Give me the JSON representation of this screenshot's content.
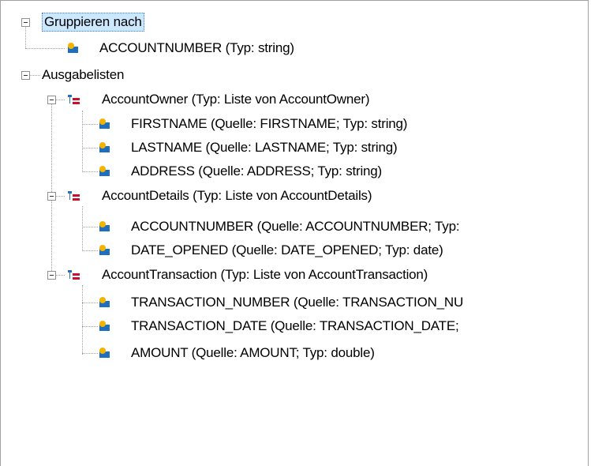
{
  "tree": {
    "group_by": {
      "label": "Gruppieren nach",
      "children": [
        {
          "label": "ACCOUNTNUMBER (Typ: string)"
        }
      ]
    },
    "output_lists": {
      "label": "Ausgabelisten",
      "lists": [
        {
          "label": "AccountOwner (Typ: Liste von AccountOwner)",
          "fields": [
            {
              "label": "FIRSTNAME (Quelle: FIRSTNAME; Typ: string)"
            },
            {
              "label": "LASTNAME (Quelle: LASTNAME; Typ: string)"
            },
            {
              "label": "ADDRESS (Quelle: ADDRESS; Typ: string)"
            }
          ]
        },
        {
          "label": "AccountDetails (Typ: Liste von AccountDetails)",
          "fields": [
            {
              "label": "ACCOUNTNUMBER (Quelle: ACCOUNTNUMBER; Typ:"
            },
            {
              "label": "DATE_OPENED (Quelle: DATE_OPENED; Typ: date)"
            }
          ]
        },
        {
          "label": "AccountTransaction (Typ: Liste von AccountTransaction)",
          "fields": [
            {
              "label": "TRANSACTION_NUMBER (Quelle: TRANSACTION_NU"
            },
            {
              "label": "TRANSACTION_DATE (Quelle: TRANSACTION_DATE;"
            },
            {
              "label": "AMOUNT (Quelle: AMOUNT; Typ: double)"
            }
          ]
        }
      ]
    }
  },
  "icons": {
    "field": "field-icon",
    "list": "list-icon",
    "expanded": "minus-expander-icon"
  },
  "colors": {
    "selection": "#cce8ff",
    "field_yellow": "#f2b400",
    "field_blue": "#1f6fbf",
    "list_red": "#c8102e",
    "list_blue": "#2a6fbd"
  }
}
